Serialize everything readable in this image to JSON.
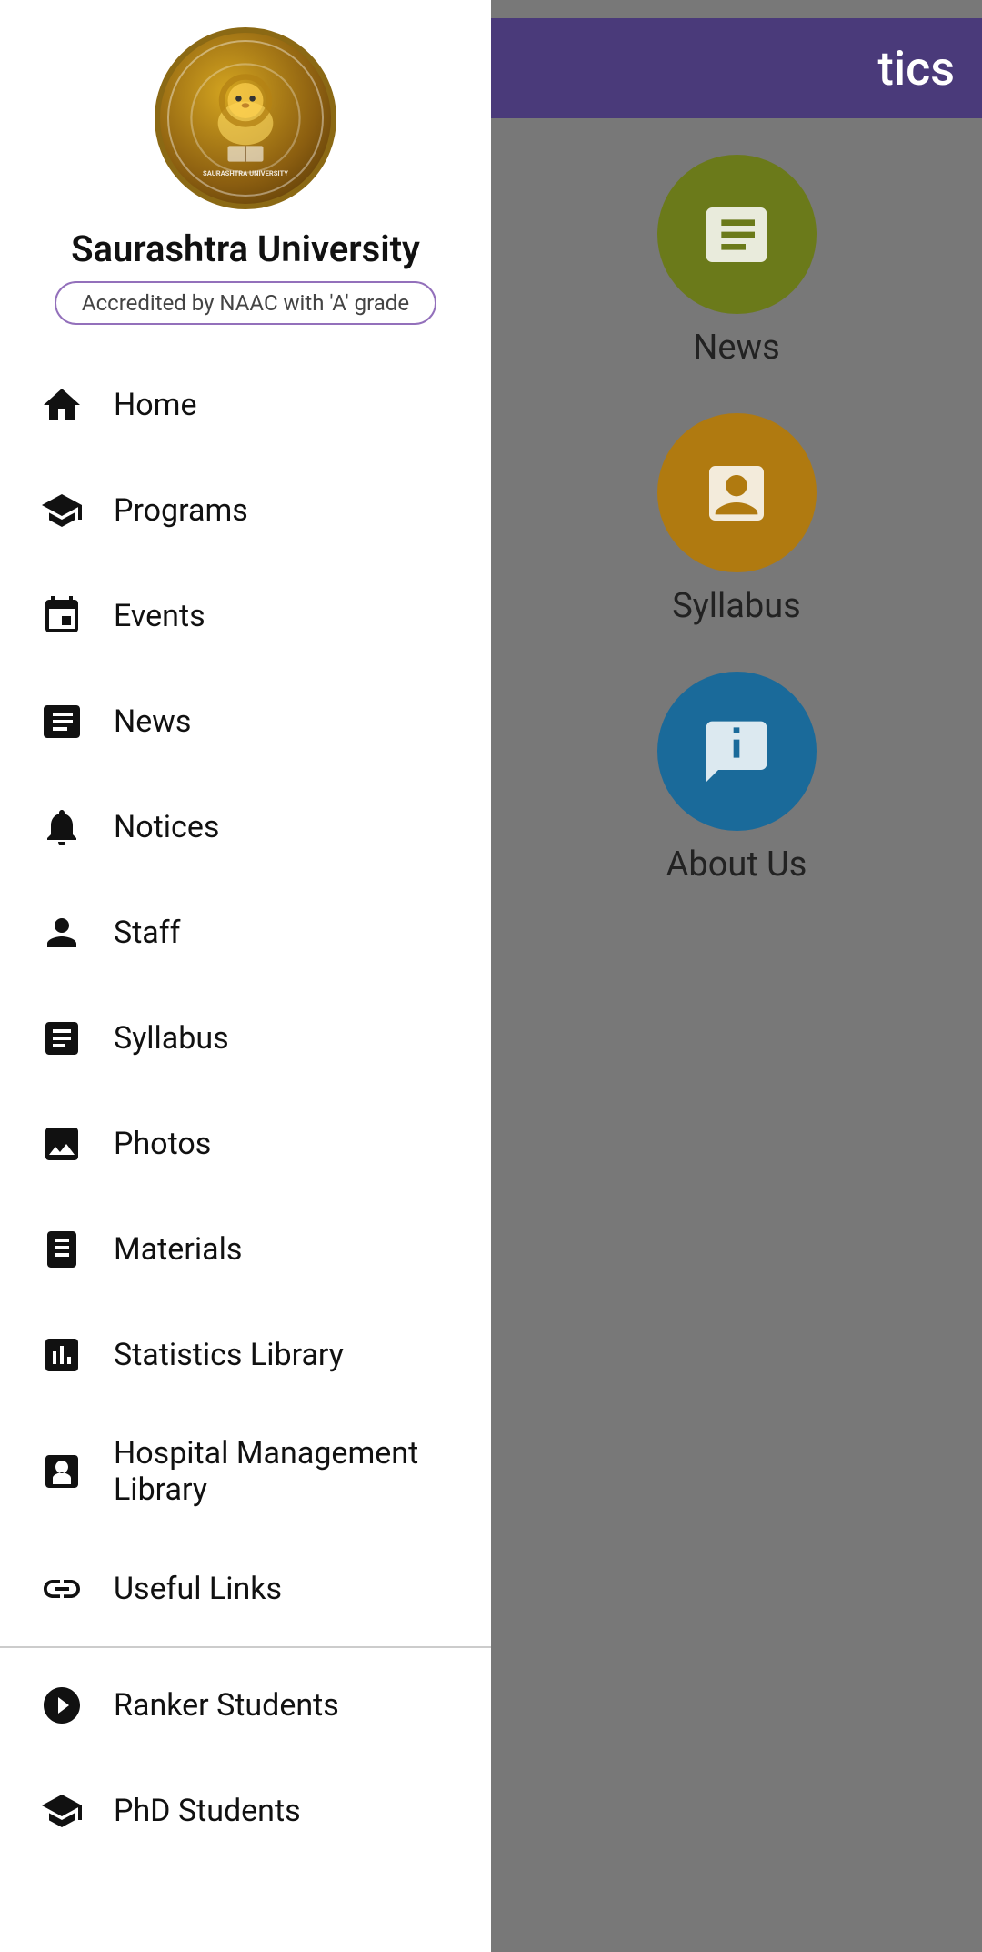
{
  "header": {
    "partial_title": "tics"
  },
  "university": {
    "name": "Saurashtra University",
    "accreditation": "Accredited by NAAC with 'A' grade"
  },
  "nav_items": [
    {
      "id": "home",
      "label": "Home",
      "icon": "home"
    },
    {
      "id": "programs",
      "label": "Programs",
      "icon": "programs"
    },
    {
      "id": "events",
      "label": "Events",
      "icon": "events"
    },
    {
      "id": "news",
      "label": "News",
      "icon": "news"
    },
    {
      "id": "notices",
      "label": "Notices",
      "icon": "notices"
    },
    {
      "id": "staff",
      "label": "Staff",
      "icon": "staff"
    },
    {
      "id": "syllabus",
      "label": "Syllabus",
      "icon": "syllabus"
    },
    {
      "id": "photos",
      "label": "Photos",
      "icon": "photos"
    },
    {
      "id": "materials",
      "label": "Materials",
      "icon": "materials"
    },
    {
      "id": "statistics-library",
      "label": "Statistics Library",
      "icon": "statistics"
    },
    {
      "id": "hospital-library",
      "label": "Hospital Management Library",
      "icon": "hospital"
    },
    {
      "id": "useful-links",
      "label": "Useful Links",
      "icon": "links"
    }
  ],
  "nav_items_bottom": [
    {
      "id": "ranker-students",
      "label": "Ranker Students",
      "icon": "ranker"
    },
    {
      "id": "phd-students",
      "label": "PhD Students",
      "icon": "phd"
    }
  ],
  "right_icons": [
    {
      "id": "news",
      "label": "News",
      "color": "green"
    },
    {
      "id": "syllabus",
      "label": "Syllabus",
      "color": "amber"
    },
    {
      "id": "about-us",
      "label": "About Us",
      "color": "blue"
    }
  ]
}
